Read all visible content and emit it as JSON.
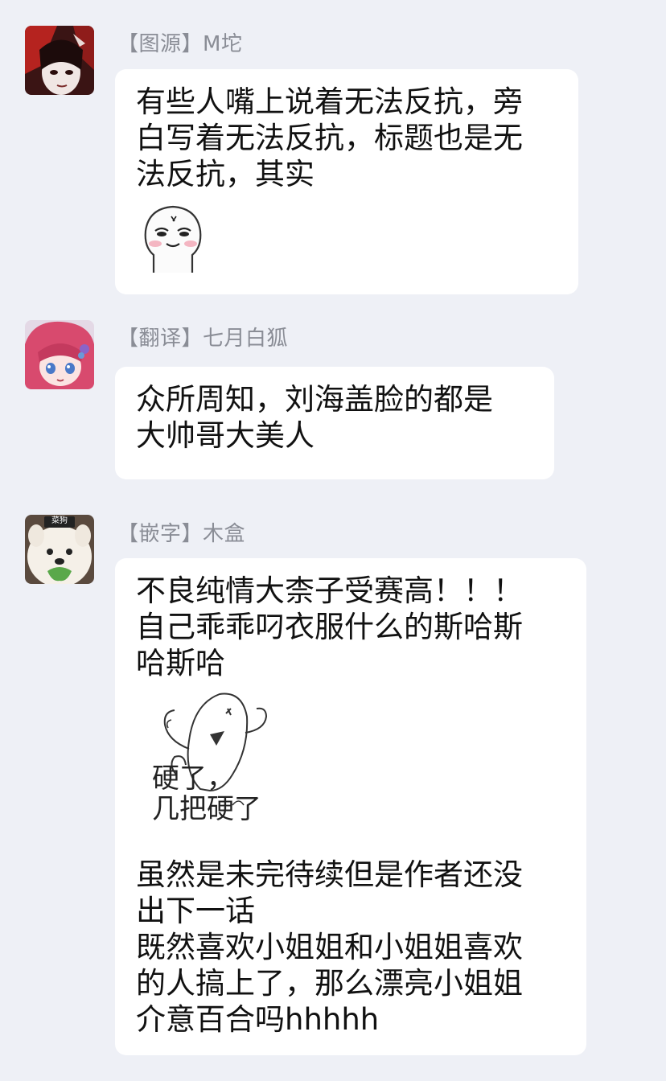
{
  "messages": [
    {
      "sender": "【图源】M坨",
      "lines": [
        "有些人嘴上说着无法反抗，旁",
        "白写着无法反抗，标题也是无",
        "法反抗，其实"
      ],
      "sticker": "blushing-face-sticker"
    },
    {
      "sender": "【翻译】七月白狐",
      "lines": [
        "众所周知，刘海盖脸的都是",
        "大帅哥大美人"
      ]
    },
    {
      "sender": "【嵌字】木盒",
      "avatar_badge": "菜狗",
      "lines_top": [
        "不良纯情大柰子受赛高！！！",
        "自己乖乖叼衣服什么的斯哈斯",
        "哈斯哈"
      ],
      "sticker": "doodle-ghost-sticker",
      "sticker_caption": [
        "硬了，",
        "几把硬了"
      ],
      "lines_bottom": [
        "虽然是未完待续但是作者还没",
        "出下一话",
        "既然喜欢小姐姐和小姐姐喜欢",
        "的人搞上了，那么漂亮小姐姐",
        "介意百合吗hhhhh"
      ]
    }
  ],
  "colors": {
    "background": "#eef0f6",
    "bubble": "#ffffff",
    "sender_text": "#8a8d96",
    "message_text": "#111111"
  }
}
